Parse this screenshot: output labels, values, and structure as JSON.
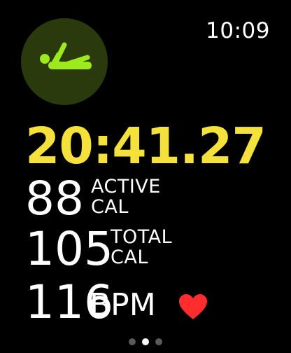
{
  "status_bar": {
    "time": "10:09"
  },
  "workout": {
    "icon": "core-training-icon",
    "accent_color": "#9cea1e",
    "icon_bg_color": "#2b3a0c"
  },
  "timer": {
    "elapsed": "20:41.27",
    "color": "#f5e13b"
  },
  "metrics": {
    "active": {
      "value": "88",
      "unit_line1": "ACTIVE",
      "unit_line2": "CAL"
    },
    "total": {
      "value": "105",
      "unit_line1": "TOTAL",
      "unit_line2": "CAL"
    },
    "heart_rate": {
      "value": "116",
      "unit": "BPM",
      "icon": "heart-icon",
      "color": "#ff2d2d"
    }
  },
  "pager": {
    "count": 3,
    "active_index": 1
  }
}
